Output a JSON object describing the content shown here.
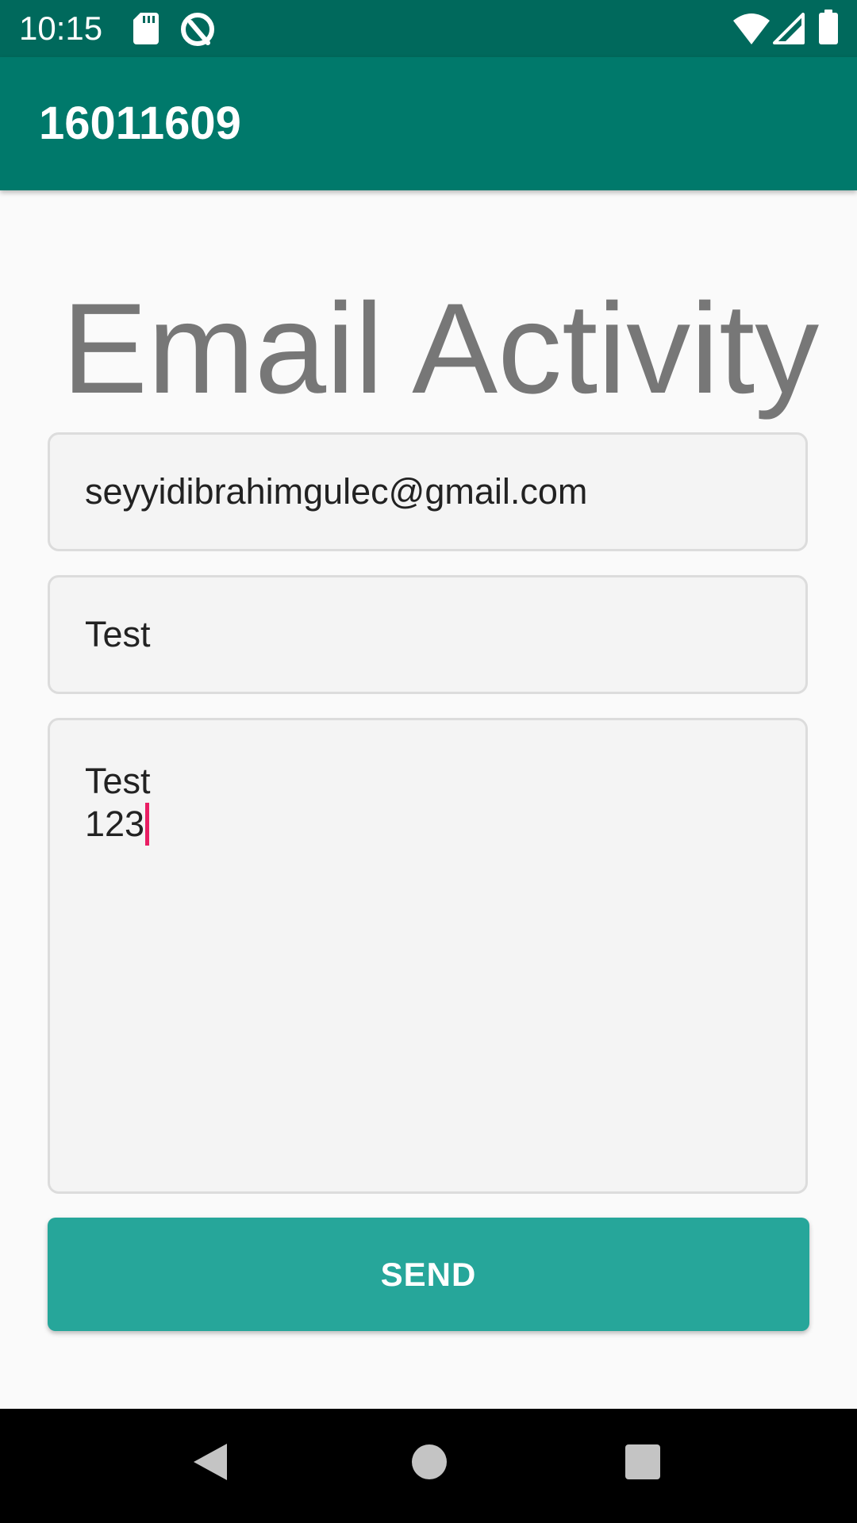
{
  "status_bar": {
    "time": "10:15",
    "icons": [
      "sd-card-icon",
      "sync-icon",
      "wifi-icon",
      "signal-icon",
      "battery-icon"
    ]
  },
  "app_bar": {
    "title": "16011609"
  },
  "main": {
    "heading": "Email Activity",
    "email_field": {
      "value": "seyyidibrahimgulec@gmail.com"
    },
    "subject_field": {
      "value": "Test"
    },
    "message_field": {
      "line1": "Test",
      "line2": "123"
    },
    "send_button": {
      "label": "SEND"
    }
  },
  "colors": {
    "status_bar": "#00695c",
    "app_bar": "#00796b",
    "button": "#26a69a",
    "caret": "#e91e63",
    "heading": "#777777"
  },
  "nav_bar": {
    "icons": [
      "back-icon",
      "home-icon",
      "recents-icon"
    ]
  }
}
